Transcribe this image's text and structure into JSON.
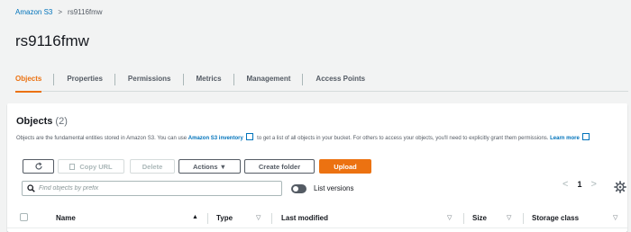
{
  "breadcrumb": {
    "root": "Amazon S3",
    "separator": ">",
    "current": "rs9116fmw"
  },
  "page": {
    "title": "rs9116fmw"
  },
  "tabs": [
    {
      "label": "Objects",
      "active": true
    },
    {
      "label": "Properties",
      "active": false
    },
    {
      "label": "Permissions",
      "active": false
    },
    {
      "label": "Metrics",
      "active": false
    },
    {
      "label": "Management",
      "active": false
    },
    {
      "label": "Access Points",
      "active": false
    }
  ],
  "objects_panel": {
    "title": "Objects",
    "count": "(2)",
    "description_prefix": "Objects are the fundamental entities stored in Amazon S3. You can use",
    "inventory_link": "Amazon S3 inventory",
    "description_middle": "to get a list of all objects in your bucket. For others to access your objects, you'll need to explicitly grant them permissions.",
    "learn_more": "Learn more",
    "buttons": {
      "refresh_icon": "refresh-icon",
      "copy_url": "Copy URL",
      "delete": "Delete",
      "actions": "Actions ▼",
      "create_folder": "Create folder",
      "upload": "Upload"
    },
    "search_placeholder": "Find objects by prefix",
    "list_versions_label": "List versions",
    "list_versions_enabled": false,
    "pagination": {
      "prev": "<",
      "page": "1",
      "next": ">"
    },
    "columns": [
      "Name",
      "Type",
      "Last modified",
      "Size",
      "Storage class"
    ],
    "sort_indicators": {
      "name": "▲",
      "other": "▽"
    }
  },
  "colors": {
    "accent": "#ec7211",
    "link": "#0073bb",
    "text": "#16191f",
    "muted": "#545b64"
  }
}
